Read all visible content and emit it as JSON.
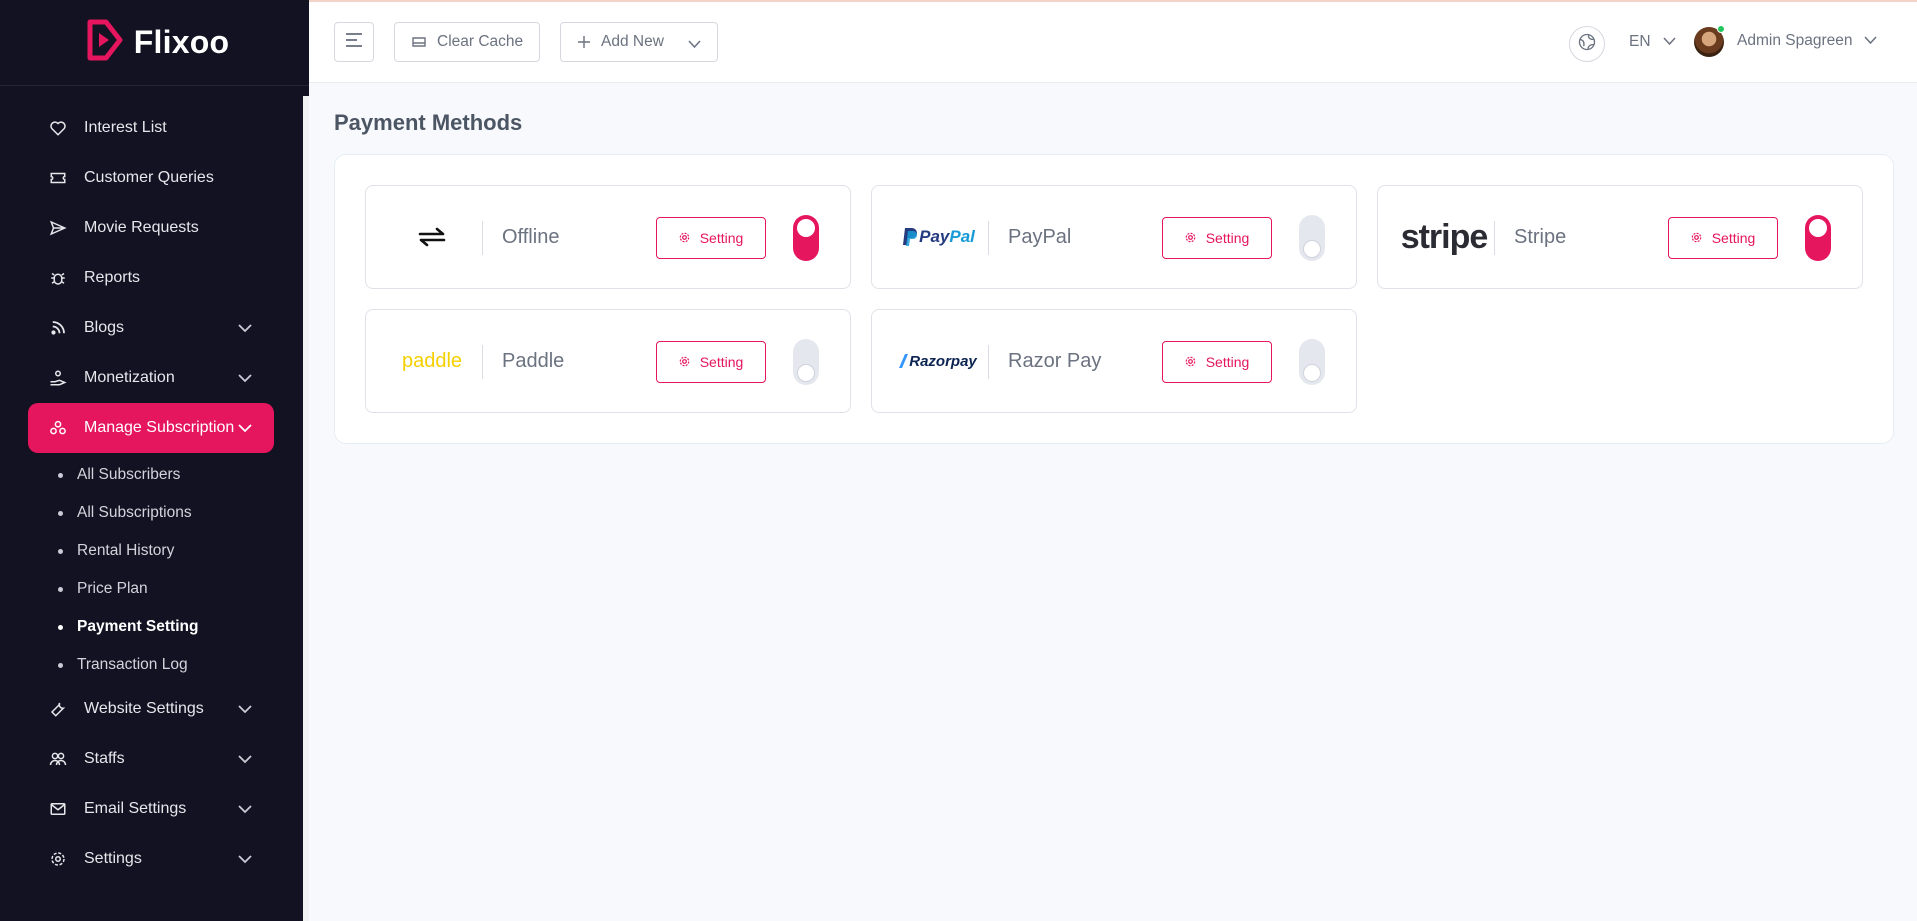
{
  "brand": {
    "name": "Flixoo",
    "accent": "#e5155e"
  },
  "sidebar": {
    "items": [
      {
        "label": "Interest List",
        "icon": "heart-icon"
      },
      {
        "label": "Customer Queries",
        "icon": "ticket-icon"
      },
      {
        "label": "Movie Requests",
        "icon": "send-icon"
      },
      {
        "label": "Reports",
        "icon": "bug-icon"
      },
      {
        "label": "Blogs",
        "icon": "rss-icon"
      },
      {
        "label": "Monetization",
        "icon": "hand-coin-icon"
      },
      {
        "label": "Manage Subscription",
        "icon": "subscription-icon"
      },
      {
        "label": "Website Settings",
        "icon": "wrench-icon"
      },
      {
        "label": "Staffs",
        "icon": "users-icon"
      },
      {
        "label": "Email Settings",
        "icon": "mail-icon"
      },
      {
        "label": "Settings",
        "icon": "gear-icon"
      }
    ],
    "subitems": [
      "All Subscribers",
      "All Subscriptions",
      "Rental History",
      "Price Plan",
      "Payment Setting",
      "Transaction Log"
    ]
  },
  "header": {
    "clear_cache": "Clear Cache",
    "add_new": "Add New",
    "language": "EN",
    "user_name": "Admin Spagreen"
  },
  "main": {
    "title": "Payment Methods",
    "setting_label": "Setting",
    "methods": [
      {
        "name": "Offline",
        "logo": "exchange-icon",
        "enabled": true
      },
      {
        "name": "PayPal",
        "logo_text": "PayPal",
        "enabled": false
      },
      {
        "name": "Stripe",
        "logo_text": "stripe",
        "enabled": true
      },
      {
        "name": "Paddle",
        "logo_text": "paddle",
        "enabled": false
      },
      {
        "name": "Razor Pay",
        "logo_text": "Razorpay",
        "enabled": false
      }
    ]
  }
}
